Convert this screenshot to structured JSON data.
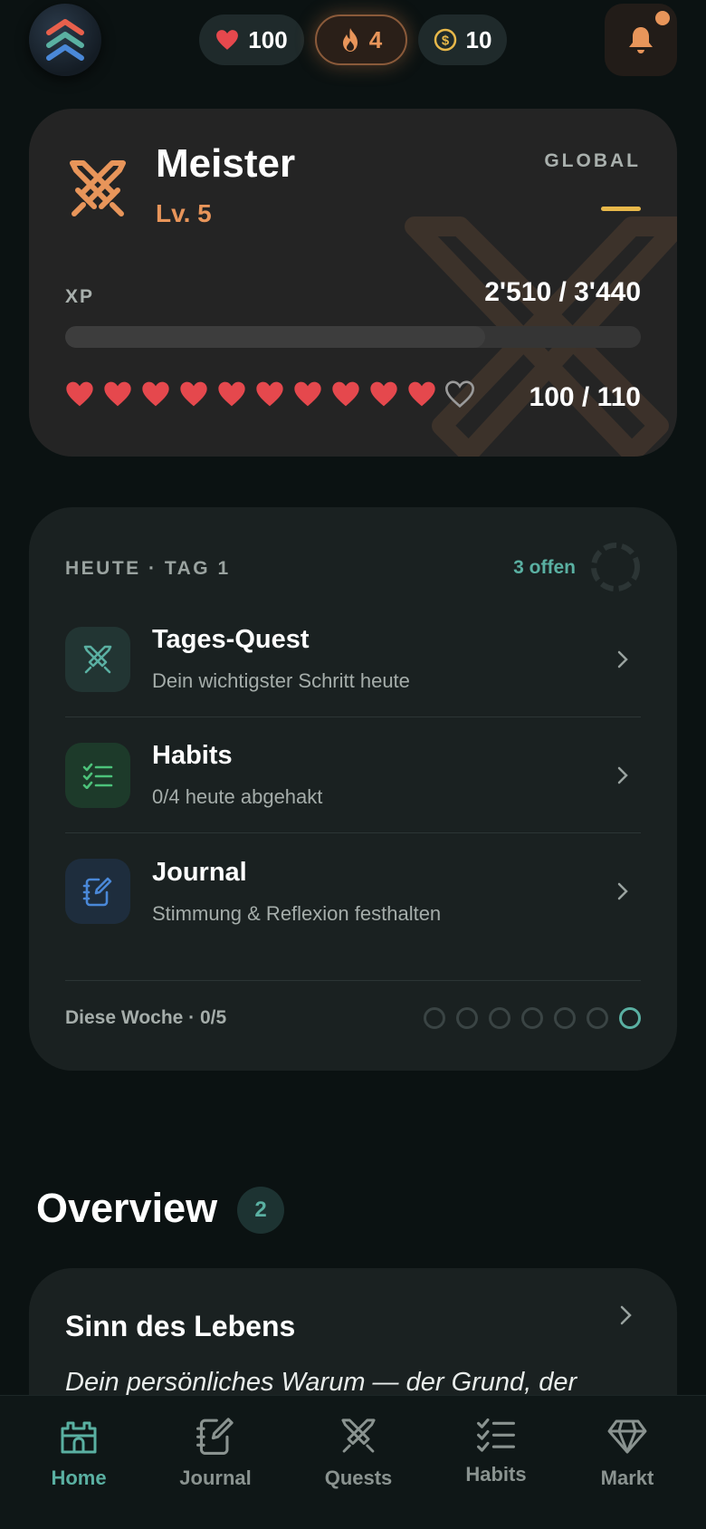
{
  "header": {
    "logo_icon": "chevrons-up-icon",
    "hp": "100",
    "streak": "4",
    "coins": "10",
    "bell_icon": "bell-icon"
  },
  "profile": {
    "class_name": "Meister",
    "level": "Lv. 5",
    "scope": "GLOBAL",
    "xp_label": "XP",
    "xp_value": "2'510 / 3'440",
    "xp_progress": 0.73,
    "hearts_full": 10,
    "hearts_total": 11,
    "hp_value": "100 / 110",
    "accent": "#e8955a"
  },
  "today": {
    "title": "HEUTE · TAG 1",
    "open_count": "3 offen",
    "tasks": [
      {
        "title": "Tages-Quest",
        "subtitle": "Dein wichtigster Schritt heute",
        "icon": "swords-icon"
      },
      {
        "title": "Habits",
        "subtitle": "0/4 heute abgehakt",
        "icon": "checklist-icon"
      },
      {
        "title": "Journal",
        "subtitle": "Stimmung & Reflexion festhalten",
        "icon": "notebook-pen-icon"
      }
    ],
    "week_label": "Diese Woche · 0/5"
  },
  "overview": {
    "title": "Overview",
    "count": "2",
    "card_title": "Sinn des Lebens",
    "card_text": "Dein persönliches Warum — der Grund, der"
  },
  "nav": {
    "items": [
      {
        "label": "Home",
        "icon": "castle-icon"
      },
      {
        "label": "Journal",
        "icon": "notebook-pen-icon"
      },
      {
        "label": "Quests",
        "icon": "swords-icon"
      },
      {
        "label": "Habits",
        "icon": "checklist-icon"
      },
      {
        "label": "Markt",
        "icon": "gem-icon"
      }
    ],
    "active": "Home"
  },
  "colors": {
    "accent_teal": "#5ab0a2",
    "accent_orange": "#e8955a",
    "heart_red": "#e5484d",
    "coin_gold": "#e8b84a"
  }
}
